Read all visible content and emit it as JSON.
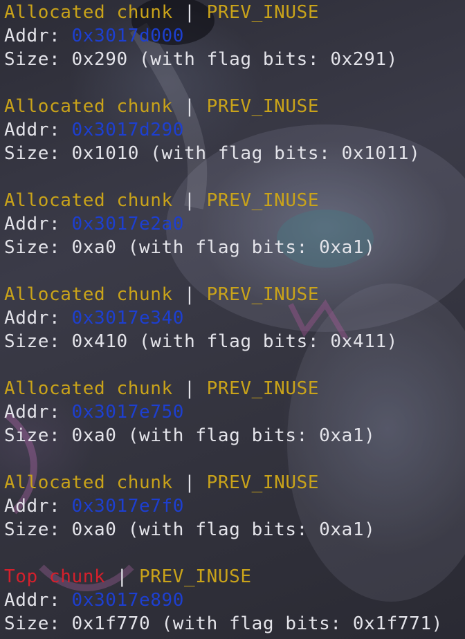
{
  "colors": {
    "allocated": "#c9a31a",
    "top": "#d4202c",
    "flag": "#c9a31a",
    "address": "#1d3fd0",
    "text": "#e4e4ea"
  },
  "labels": {
    "separator": " | ",
    "addr_prefix": "Addr: ",
    "size_prefix": "Size: "
  },
  "chunks": [
    {
      "type": "Allocated chunk",
      "flag": "PREV_INUSE",
      "addr": "0x3017d000",
      "size_text": "0x290 (with flag bits: 0x291)"
    },
    {
      "type": "Allocated chunk",
      "flag": "PREV_INUSE",
      "addr": "0x3017d290",
      "size_text": "0x1010 (with flag bits: 0x1011)"
    },
    {
      "type": "Allocated chunk",
      "flag": "PREV_INUSE",
      "addr": "0x3017e2a0",
      "size_text": "0xa0 (with flag bits: 0xa1)"
    },
    {
      "type": "Allocated chunk",
      "flag": "PREV_INUSE",
      "addr": "0x3017e340",
      "size_text": "0x410 (with flag bits: 0x411)"
    },
    {
      "type": "Allocated chunk",
      "flag": "PREV_INUSE",
      "addr": "0x3017e750",
      "size_text": "0xa0 (with flag bits: 0xa1)"
    },
    {
      "type": "Allocated chunk",
      "flag": "PREV_INUSE",
      "addr": "0x3017e7f0",
      "size_text": "0xa0 (with flag bits: 0xa1)"
    },
    {
      "type": "Top chunk",
      "flag": "PREV_INUSE",
      "addr": "0x3017e890",
      "size_text": "0x1f770 (with flag bits: 0x1f771)"
    }
  ]
}
